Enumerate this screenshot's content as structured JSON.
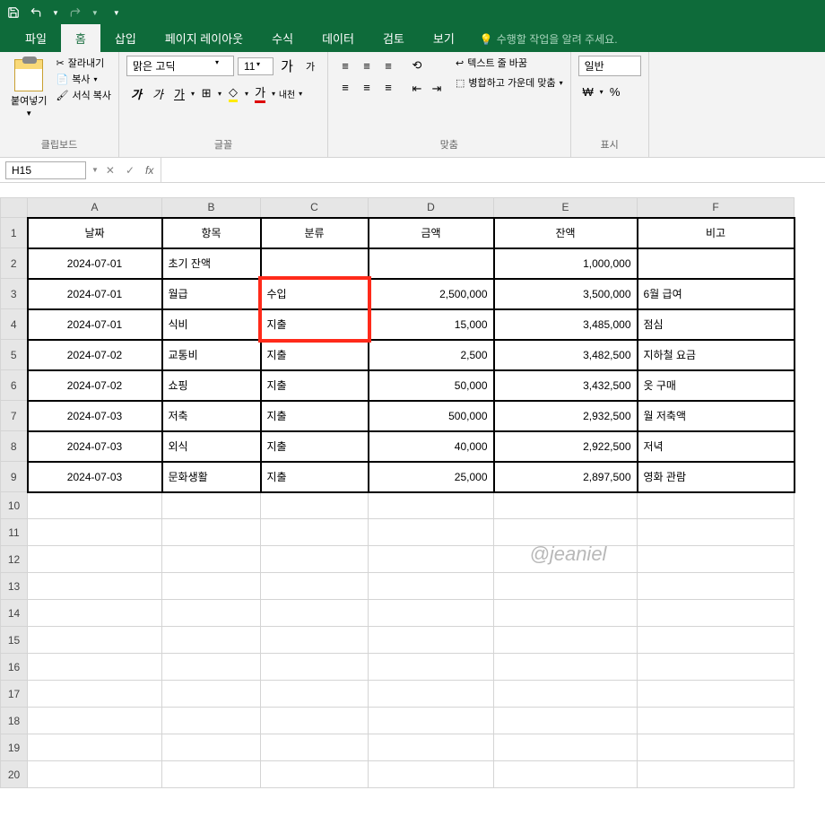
{
  "titlebar": {
    "save": "save-icon",
    "undo": "undo-icon",
    "redo": "redo-icon"
  },
  "tabs": {
    "file": "파일",
    "home": "홈",
    "insert": "삽입",
    "layout": "페이지 레이아웃",
    "formula": "수식",
    "data": "데이터",
    "review": "검토",
    "view": "보기",
    "tellme": "수행할 작업을 알려 주세요."
  },
  "ribbon": {
    "clipboard": {
      "paste": "붙여넣기",
      "cut": "잘라내기",
      "copy": "복사",
      "format_painter": "서식 복사",
      "label": "클립보드"
    },
    "font": {
      "name": "맑은 고딕",
      "size": "11",
      "increase": "가",
      "decrease": "가",
      "label": "글꼴"
    },
    "alignment": {
      "wrap": "텍스트 줄 바꿈",
      "merge": "병합하고 가운데 맞춤",
      "label": "맞춤",
      "indent": "내천"
    },
    "number": {
      "general": "일반",
      "label": "표시"
    }
  },
  "namebox": {
    "value": "H15"
  },
  "columns": [
    "A",
    "B",
    "C",
    "D",
    "E",
    "F"
  ],
  "headers": {
    "A": "날짜",
    "B": "항목",
    "C": "분류",
    "D": "금액",
    "E": "잔액",
    "F": "비고"
  },
  "rows": [
    {
      "A": "2024-07-01",
      "B": "초기 잔액",
      "C": "",
      "D": "",
      "E": "1,000,000",
      "F": ""
    },
    {
      "A": "2024-07-01",
      "B": "월급",
      "C": "수입",
      "D": "2,500,000",
      "E": "3,500,000",
      "F": "6월 급여"
    },
    {
      "A": "2024-07-01",
      "B": "식비",
      "C": "지출",
      "D": "15,000",
      "E": "3,485,000",
      "F": "점심"
    },
    {
      "A": "2024-07-02",
      "B": "교통비",
      "C": "지출",
      "D": "2,500",
      "E": "3,482,500",
      "F": "지하철 요금"
    },
    {
      "A": "2024-07-02",
      "B": "쇼핑",
      "C": "지출",
      "D": "50,000",
      "E": "3,432,500",
      "F": "옷 구매"
    },
    {
      "A": "2024-07-03",
      "B": "저축",
      "C": "지출",
      "D": "500,000",
      "E": "2,932,500",
      "F": "월 저축액"
    },
    {
      "A": "2024-07-03",
      "B": "외식",
      "C": "지출",
      "D": "40,000",
      "E": "2,922,500",
      "F": "저녁"
    },
    {
      "A": "2024-07-03",
      "B": "문화생활",
      "C": "지출",
      "D": "25,000",
      "E": "2,897,500",
      "F": "영화 관람"
    }
  ],
  "watermark": "@jeaniel"
}
